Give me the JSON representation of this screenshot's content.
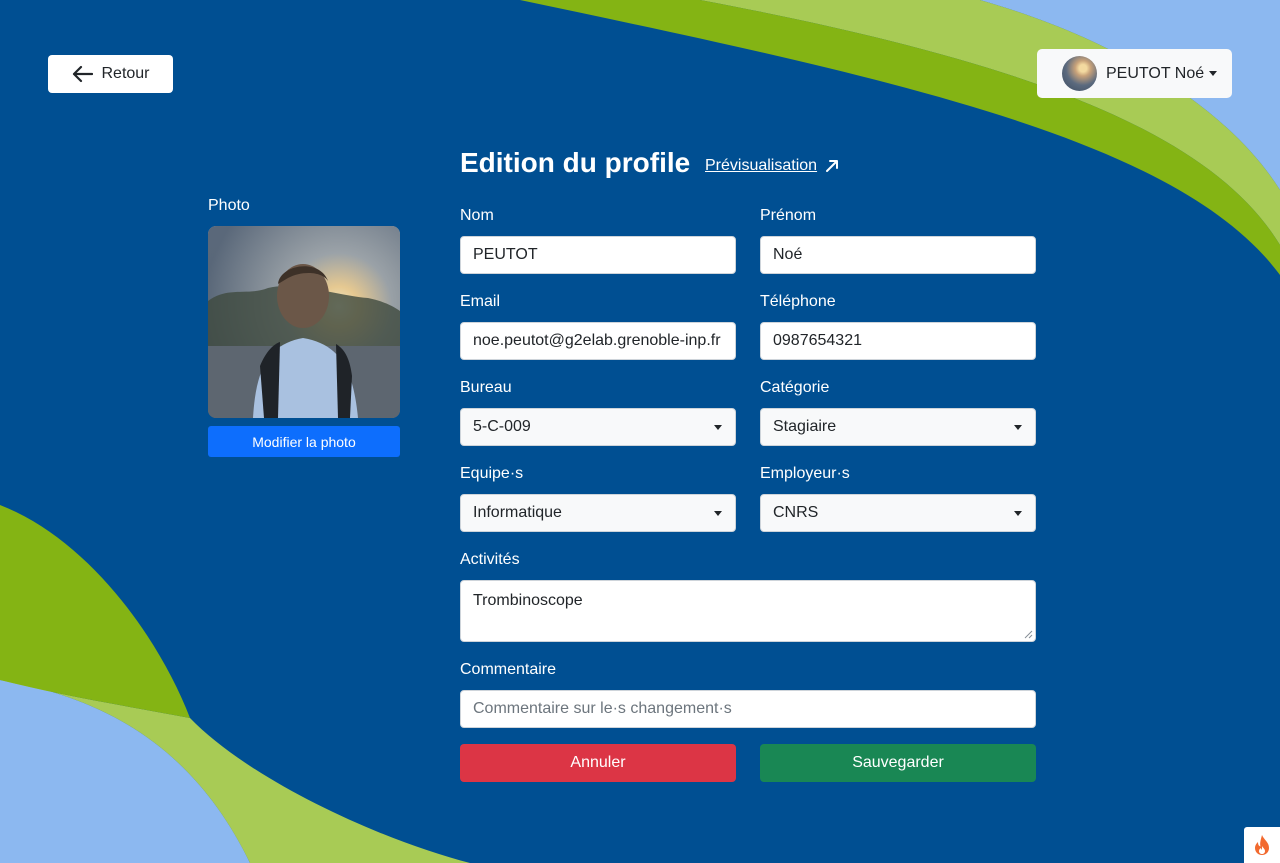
{
  "header": {
    "back_label": "Retour",
    "user_name": "PEUTOT Noé"
  },
  "photo": {
    "label": "Photo",
    "button_label": "Modifier la photo"
  },
  "form": {
    "title": "Edition du profile",
    "preview_label": "Prévisualisation",
    "nom": {
      "label": "Nom",
      "value": "PEUTOT"
    },
    "prenom": {
      "label": "Prénom",
      "value": "Noé"
    },
    "email": {
      "label": "Email",
      "value": "noe.peutot@g2elab.grenoble-inp.fr"
    },
    "telephone": {
      "label": "Téléphone",
      "value": "0987654321"
    },
    "bureau": {
      "label": "Bureau",
      "value": "5-C-009"
    },
    "categorie": {
      "label": "Catégorie",
      "value": "Stagiaire"
    },
    "equipes": {
      "label": "Equipe·s",
      "value": "Informatique"
    },
    "employeurs": {
      "label": "Employeur·s",
      "value": "CNRS"
    },
    "activites": {
      "label": "Activités",
      "value": "Trombinoscope"
    },
    "commentaire": {
      "label": "Commentaire",
      "placeholder": "Commentaire sur le·s changement·s",
      "value": ""
    },
    "cancel_label": "Annuler",
    "save_label": "Sauvegarder"
  },
  "colors": {
    "background": "#004f92",
    "accent_green": "#84b414",
    "light_green": "#a8cb55",
    "light_blue": "#8cb8f0",
    "primary_button": "#0d6efd",
    "danger_button": "#dc3545",
    "success_button": "#198754"
  },
  "icons": {
    "back": "arrow-left-icon",
    "preview": "arrow-up-right-icon",
    "user_caret": "caret-down-icon",
    "select_caret": "caret-down-icon",
    "corner": "flame-icon"
  }
}
